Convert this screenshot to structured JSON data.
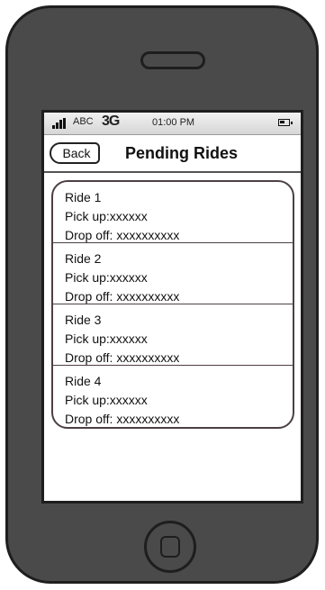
{
  "status_bar": {
    "carrier": "ABC",
    "network": "3G",
    "time": "01:00 PM"
  },
  "nav": {
    "back_label": "Back",
    "title": "Pending Rides"
  },
  "rides": [
    {
      "title": "Ride 1",
      "pickup": "Pick up:xxxxxx",
      "dropoff": "Drop off: xxxxxxxxxx"
    },
    {
      "title": "Ride 2",
      "pickup": "Pick up:xxxxxx",
      "dropoff": "Drop off: xxxxxxxxxx"
    },
    {
      "title": "Ride 3",
      "pickup": "Pick up:xxxxxx",
      "dropoff": "Drop off: xxxxxxxxxx"
    },
    {
      "title": "Ride 4",
      "pickup": "Pick up:xxxxxx",
      "dropoff": "Drop off: xxxxxxxxxx"
    }
  ],
  "colors": {
    "phone_body": "#4a4a4a",
    "list_border": "#4c4043"
  },
  "icons": [
    "signal-icon",
    "battery-icon",
    "home-button-icon"
  ]
}
